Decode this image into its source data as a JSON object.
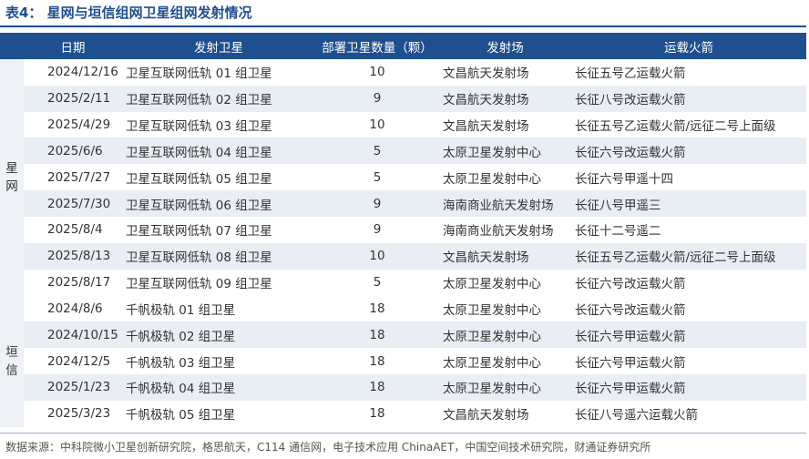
{
  "title": "表4：  星网与垣信组网卫星组网发射情况",
  "headers": [
    "日期",
    "发射卫星",
    "部署卫星数量（颗）",
    "发射场",
    "运载火箭"
  ],
  "groups": [
    {
      "label": "星网",
      "rows": [
        {
          "date": "2024/12/16",
          "satellite": "卫星互联网低轨 01 组卫星",
          "count": "10",
          "site": "文昌航天发射场",
          "rocket": "长征五号乙运载火箭"
        },
        {
          "date": "2025/2/11",
          "satellite": "卫星互联网低轨 02 组卫星",
          "count": "9",
          "site": "文昌航天发射场",
          "rocket": "长征八号改运载火箭"
        },
        {
          "date": "2025/4/29",
          "satellite": "卫星互联网低轨 03 组卫星",
          "count": "10",
          "site": "文昌航天发射场",
          "rocket": "长征五号乙运载火箭/远征二号上面级"
        },
        {
          "date": "2025/6/6",
          "satellite": "卫星互联网低轨 04 组卫星",
          "count": "5",
          "site": "太原卫星发射中心",
          "rocket": "长征六号改运载火箭"
        },
        {
          "date": "2025/7/27",
          "satellite": "卫星互联网低轨 05 组卫星",
          "count": "5",
          "site": "太原卫星发射中心",
          "rocket": "长征六号甲遥十四"
        },
        {
          "date": "2025/7/30",
          "satellite": "卫星互联网低轨 06 组卫星",
          "count": "9",
          "site": "海南商业航天发射场",
          "rocket": "长征八号甲遥三"
        },
        {
          "date": "2025/8/4",
          "satellite": "卫星互联网低轨 07 组卫星",
          "count": "9",
          "site": "海南商业航天发射场",
          "rocket": "长征十二号遥二"
        },
        {
          "date": "2025/8/13",
          "satellite": "卫星互联网低轨 08 组卫星",
          "count": "10",
          "site": "文昌航天发射场",
          "rocket": "长征五号乙运载火箭/远征二号上面级"
        },
        {
          "date": "2025/8/17",
          "satellite": "卫星互联网低轨 09 组卫星",
          "count": "5",
          "site": "太原卫星发射中心",
          "rocket": "长征六号改运载火箭"
        }
      ]
    },
    {
      "label": "垣信",
      "rows": [
        {
          "date": "2024/8/6",
          "satellite": "千帆极轨 01 组卫星",
          "count": "18",
          "site": "太原卫星发射中心",
          "rocket": "长征六号改运载火箭"
        },
        {
          "date": "2024/10/15",
          "satellite": "千帆极轨 02 组卫星",
          "count": "18",
          "site": "太原卫星发射中心",
          "rocket": "长征六号甲运载火箭"
        },
        {
          "date": "2024/12/5",
          "satellite": "千帆极轨 03 组卫星",
          "count": "18",
          "site": "太原卫星发射中心",
          "rocket": "长征六号甲运载火箭"
        },
        {
          "date": "2025/1/23",
          "satellite": "千帆极轨 04 组卫星",
          "count": "18",
          "site": "太原卫星发射中心",
          "rocket": "长征六号甲运载火箭"
        },
        {
          "date": "2025/3/23",
          "satellite": "千帆极轨 05 组卫星",
          "count": "18",
          "site": "文昌航天发射场",
          "rocket": "长征八号遥六运载火箭"
        }
      ]
    }
  ],
  "source": "数据来源：中科院微小卫星创新研究院，格思航天，C114 通信网，电子技术应用 ChinaAET，中国空间技术研究院，财通证券研究所",
  "colors": {
    "header_bg": "#1e4f8f",
    "stripe": "#e9edf4",
    "group_bg": "#eef1f6"
  }
}
